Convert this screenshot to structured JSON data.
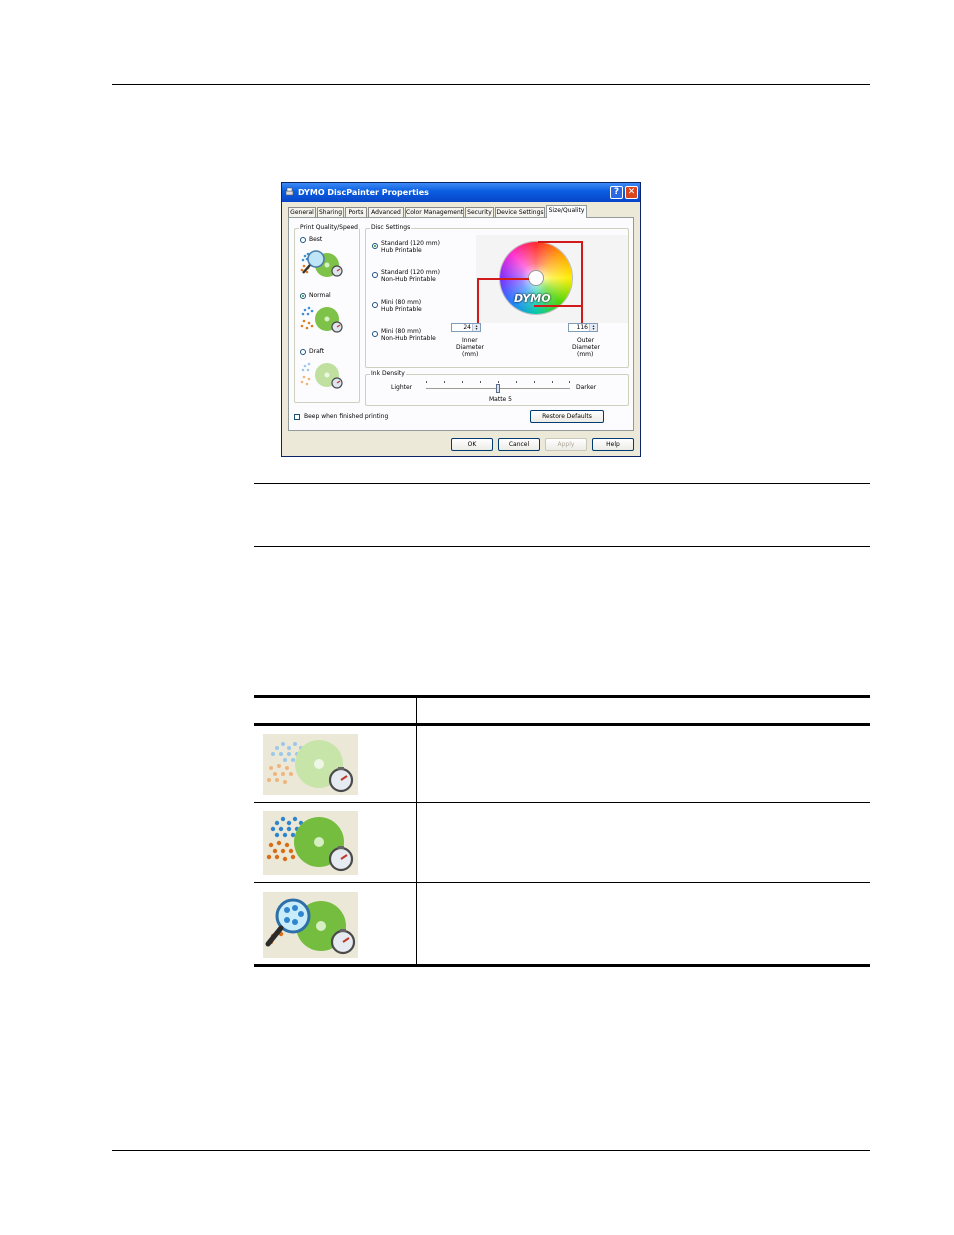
{
  "dialog": {
    "title": "DYMO DiscPainter Properties",
    "help_symbol": "?",
    "close_symbol": "✕",
    "tabs": [
      {
        "label": "General"
      },
      {
        "label": "Sharing"
      },
      {
        "label": "Ports"
      },
      {
        "label": "Advanced"
      },
      {
        "label": "Color Management"
      },
      {
        "label": "Security"
      },
      {
        "label": "Device Settings"
      },
      {
        "label": "Size/Quality"
      }
    ],
    "active_tab": "Size/Quality",
    "print_quality": {
      "group_label": "Print Quality/Speed",
      "options": [
        {
          "label": "Best",
          "selected": false
        },
        {
          "label": "Normal",
          "selected": true
        },
        {
          "label": "Draft",
          "selected": false
        }
      ]
    },
    "disc_settings": {
      "group_label": "Disc Settings",
      "options": [
        {
          "line1": "Standard (120 mm)",
          "line2": "Hub Printable",
          "selected": true
        },
        {
          "line1": "Standard (120 mm)",
          "line2": "Non-Hub Printable",
          "selected": false
        },
        {
          "line1": "Mini (80 mm)",
          "line2": "Hub Printable",
          "selected": false
        },
        {
          "line1": "Mini (80 mm)",
          "line2": "Non-Hub Printable",
          "selected": false
        }
      ],
      "disc_logo": "DYMO",
      "inner_diameter": {
        "value": "24",
        "label_line1": "Inner",
        "label_line2": "Diameter",
        "label_line3": "(mm)"
      },
      "outer_diameter": {
        "value": "116",
        "label_line1": "Outer",
        "label_line2": "Diameter",
        "label_line3": "(mm)"
      },
      "accent_color": "#d21a1a"
    },
    "ink_density": {
      "group_label": "Ink Density",
      "left_label": "Lighter",
      "right_label": "Darker",
      "value_label": "Matte 5",
      "position_fraction": 0.5
    },
    "beep_checkbox": {
      "label": "Beep when finished printing",
      "checked": false
    },
    "restore_button": "Restore Defaults",
    "buttons": {
      "ok": "OK",
      "cancel": "Cancel",
      "apply": "Apply",
      "help": "Help"
    },
    "titlebar_color": "#0a5ce0"
  },
  "table": {
    "headers": [
      "",
      ""
    ],
    "rows": [
      {
        "icon": "draft-quality-icon",
        "text": ""
      },
      {
        "icon": "normal-quality-icon",
        "text": ""
      },
      {
        "icon": "best-quality-icon",
        "text": ""
      }
    ]
  }
}
